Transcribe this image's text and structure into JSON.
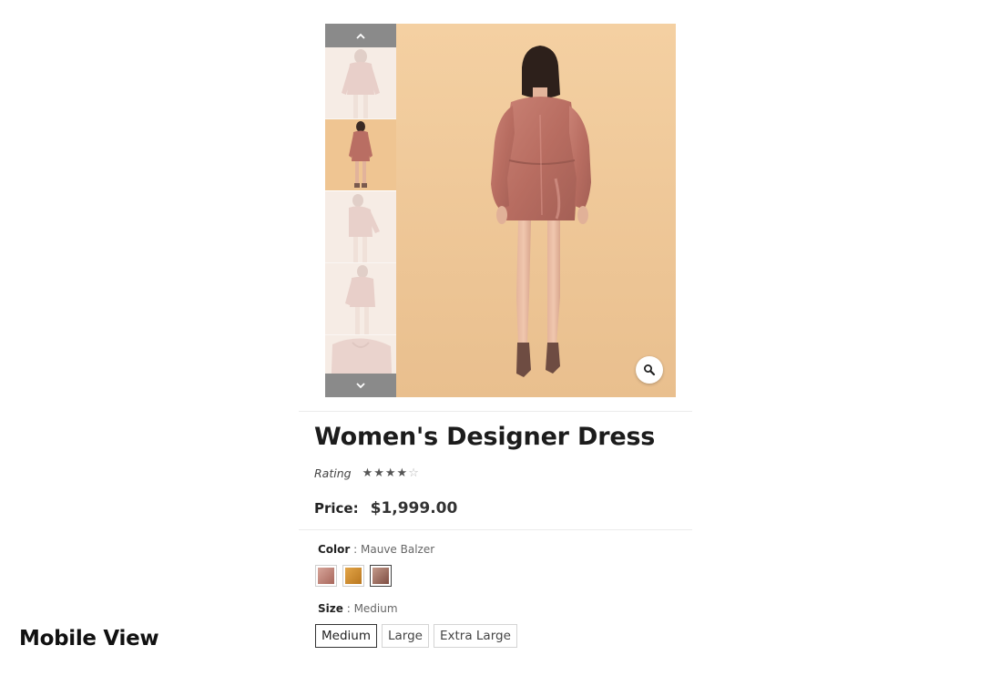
{
  "caption": "Mobile View",
  "gallery": {
    "up_icon": "chevron-up-icon",
    "down_icon": "chevron-down-icon",
    "zoom_icon": "magnifier-icon"
  },
  "product": {
    "title": "Women's Designer Dress",
    "rating_label": "Rating",
    "rating_value": 4,
    "rating_max": 5,
    "price_label": "Price:",
    "price_value": "$1,999.00"
  },
  "color": {
    "label": "Color",
    "separator": " : ",
    "value": "Mauve Balzer",
    "swatches": [
      {
        "color": "#b9847a"
      },
      {
        "color": "#d4912d"
      },
      {
        "color": "#9a6a5e"
      }
    ]
  },
  "size": {
    "label": "Size",
    "separator": " : ",
    "value": "Medium",
    "options": [
      "Medium",
      "Large",
      "Extra Large"
    ]
  },
  "colors": {
    "dress": "#c27c6f",
    "background": "#f0c896"
  }
}
